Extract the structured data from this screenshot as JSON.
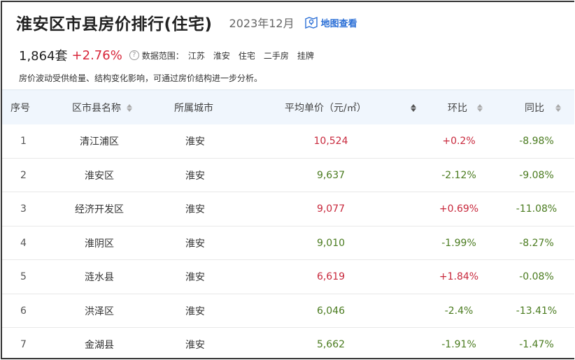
{
  "header": {
    "title": "淮安区市县房价排行(住宅)",
    "date": "2023年12月",
    "map_link": "地图查看"
  },
  "summary": {
    "count": "1,864套",
    "change": "+2.76%",
    "help": "?",
    "scope_label": "数据范围：",
    "scope_tags": [
      "江苏",
      "淮安",
      "住宅",
      "二手房",
      "挂牌"
    ]
  },
  "note": "房价波动受供给量、结构变化影响，可通过房价结构进一步分析。",
  "table": {
    "columns": [
      "序号",
      "区市县名称",
      "所属城市",
      "平均单价（元/㎡）",
      "环比",
      "同比"
    ],
    "rows": [
      {
        "idx": "1",
        "name": "清江浦区",
        "city": "淮安",
        "price": "10,524",
        "price_trend": "up",
        "mom": "+0.2%",
        "mom_trend": "up",
        "yoy": "-8.98%",
        "yoy_trend": "down"
      },
      {
        "idx": "2",
        "name": "淮安区",
        "city": "淮安",
        "price": "9,637",
        "price_trend": "down",
        "mom": "-2.12%",
        "mom_trend": "down",
        "yoy": "-9.08%",
        "yoy_trend": "down"
      },
      {
        "idx": "3",
        "name": "经济开发区",
        "city": "淮安",
        "price": "9,077",
        "price_trend": "up",
        "mom": "+0.69%",
        "mom_trend": "up",
        "yoy": "-11.08%",
        "yoy_trend": "down"
      },
      {
        "idx": "4",
        "name": "淮阴区",
        "city": "淮安",
        "price": "9,010",
        "price_trend": "down",
        "mom": "-1.99%",
        "mom_trend": "down",
        "yoy": "-8.27%",
        "yoy_trend": "down"
      },
      {
        "idx": "5",
        "name": "涟水县",
        "city": "淮安",
        "price": "6,619",
        "price_trend": "up",
        "mom": "+1.84%",
        "mom_trend": "up",
        "yoy": "-0.08%",
        "yoy_trend": "down"
      },
      {
        "idx": "6",
        "name": "洪泽区",
        "city": "淮安",
        "price": "6,046",
        "price_trend": "down",
        "mom": "-2.4%",
        "mom_trend": "down",
        "yoy": "-13.41%",
        "yoy_trend": "down"
      },
      {
        "idx": "7",
        "name": "金湖县",
        "city": "淮安",
        "price": "5,662",
        "price_trend": "down",
        "mom": "-1.91%",
        "mom_trend": "down",
        "yoy": "-1.47%",
        "yoy_trend": "down"
      }
    ]
  },
  "colors": {
    "up": "#c8283c",
    "down": "#4a7b1f",
    "link": "#2b6fd6",
    "header_bg": "#f0f6fd"
  }
}
